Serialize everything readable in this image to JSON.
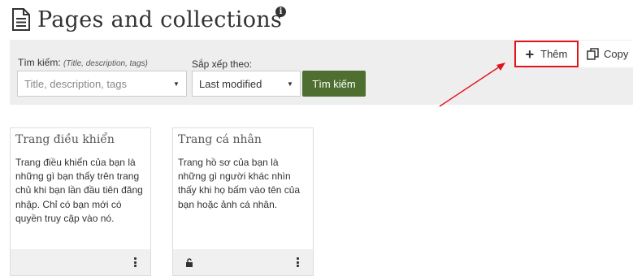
{
  "header": {
    "title": "Pages and collections",
    "page_icon": "document-icon",
    "info_icon": "info-icon",
    "info_glyph": "i"
  },
  "filter": {
    "search_label": "Tìm kiếm:",
    "search_hint": "(Title, description, tags)",
    "search_placeholder": "Title, description, tags",
    "sort_label": "Sắp xếp theo:",
    "sort_value": "Last modified",
    "search_button": "Tìm kiếm"
  },
  "actions": {
    "add_label": "Thêm",
    "copy_label": "Copy"
  },
  "cards": [
    {
      "title": "Trang điều khiển",
      "description": "Trang điều khiển của bạn là những gì bạn thấy trên trang chủ khi bạn lần đầu tiên đăng nhập. Chỉ có bạn mới có quyền truy cập vào nó."
    },
    {
      "title": "Trang cá nhân",
      "description": "Trang hồ sơ của bạn là những gì người khác nhìn thấy khi họ bấm vào tên của bạn hoặc ảnh cá nhân."
    }
  ],
  "colors": {
    "accent_green": "#4e6f2f",
    "highlight_red": "#e0141a",
    "filter_bg": "#eeeeee"
  }
}
